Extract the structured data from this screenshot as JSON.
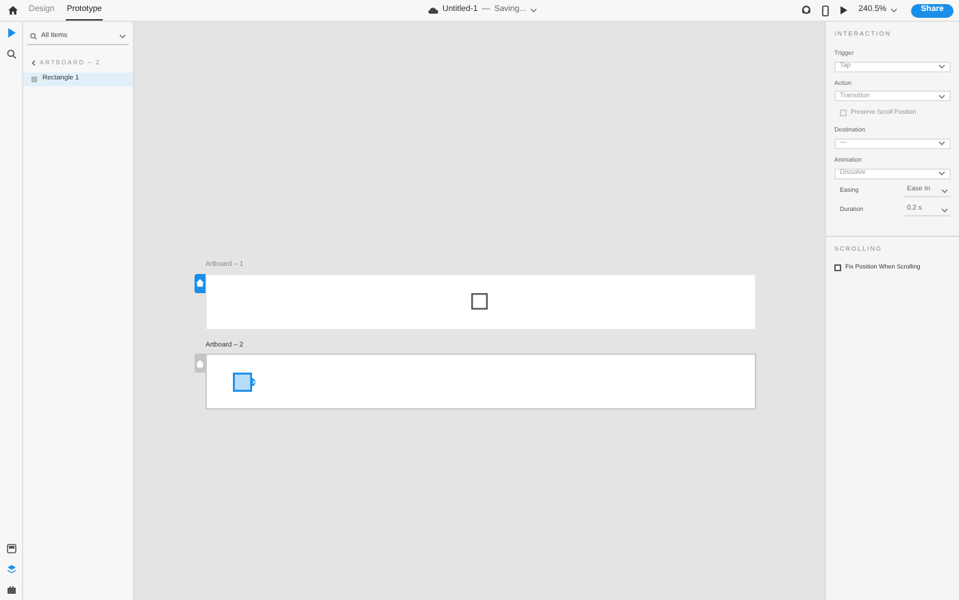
{
  "topbar": {
    "tabs": [
      {
        "label": "Design",
        "selected": false
      },
      {
        "label": "Prototype",
        "selected": true
      }
    ],
    "document_title": "Untitled-1",
    "separator": "—",
    "status": "Saving...",
    "zoom": "240.5%",
    "share": "Share"
  },
  "toolbar": {
    "tools": [
      {
        "kind": "select",
        "selected": true
      },
      {
        "kind": "search",
        "selected": false
      }
    ],
    "bottom": [
      {
        "kind": "assets",
        "selected": false
      },
      {
        "kind": "layers",
        "selected": true
      },
      {
        "kind": "plugins",
        "selected": false
      }
    ]
  },
  "layers": {
    "filter": "All Items",
    "breadcrumb": "ARTBOARD – 2",
    "items": [
      {
        "label": "Rectangle 1",
        "selected": true
      }
    ]
  },
  "canvas": {
    "artboards": [
      {
        "name": "Artboard – 1",
        "home": true,
        "selected": false,
        "shape": {
          "selected": false
        }
      },
      {
        "name": "Artboard – 2",
        "home": false,
        "selected": true,
        "shape": {
          "selected": true
        }
      }
    ]
  },
  "inspector": {
    "sections": [
      {
        "title": "INTERACTION",
        "fields": [
          {
            "kind": "dropdown",
            "label": "Trigger",
            "value": "Tap"
          },
          {
            "kind": "dropdown",
            "label": "Action",
            "value": "Transition"
          },
          {
            "kind": "checkbox",
            "label": "Preserve Scroll Position",
            "checked": false,
            "disabled": true
          },
          {
            "kind": "dropdown",
            "label": "Destination",
            "value": "—"
          },
          {
            "kind": "dropdown",
            "label": "Animation",
            "value": "Dissolve"
          },
          {
            "kind": "inline",
            "label": "Easing",
            "value": "Ease In"
          },
          {
            "kind": "inline",
            "label": "Duration",
            "value": "0.2 s"
          }
        ]
      },
      {
        "title": "SCROLLING",
        "fields": [
          {
            "kind": "checkbox",
            "label": "Fix Position When Scrolling",
            "checked": false,
            "disabled": false
          }
        ]
      }
    ]
  }
}
